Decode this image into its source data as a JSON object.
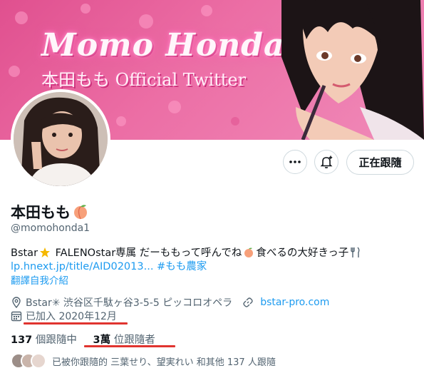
{
  "banner": {
    "title": "Momo Honda",
    "subtitle": "本田もも Official Twitter"
  },
  "actions": {
    "more_icon": "more-horizontal-icon",
    "notify_icon": "bell-plus-icon",
    "follow_label": "正在跟隨"
  },
  "profile": {
    "display_name": "本田もも",
    "name_emoji": "peach-icon",
    "handle": "@momohonda1",
    "bio_part1": "Bstar",
    "bio_part2": " FALENOstar専属 だーももって呼んでね",
    "bio_part3": "食べるの大好きっ子",
    "bio_link": "lp.hnext.jp/title/AID02013...",
    "bio_hashtag": "#もも農家",
    "translate_label": "翻譯自我介紹"
  },
  "meta": {
    "location": "Bstar✳︎ 渋谷区千駄ヶ谷3-5-5 ピッコロオペラ",
    "website": "bstar-pro.com",
    "joined": "已加入 2020年12月"
  },
  "stats": {
    "following_count": "137",
    "following_label": "個跟隨中",
    "followers_count": "3萬",
    "followers_label": "位跟隨者"
  },
  "followed_by": {
    "text": "已被你跟隨的 三葉せり、望実れい 和其他 137 人跟隨"
  },
  "colors": {
    "accent": "#1d9bf0",
    "banner_pink": "#e0508f",
    "annotation_red": "#e0342f"
  }
}
